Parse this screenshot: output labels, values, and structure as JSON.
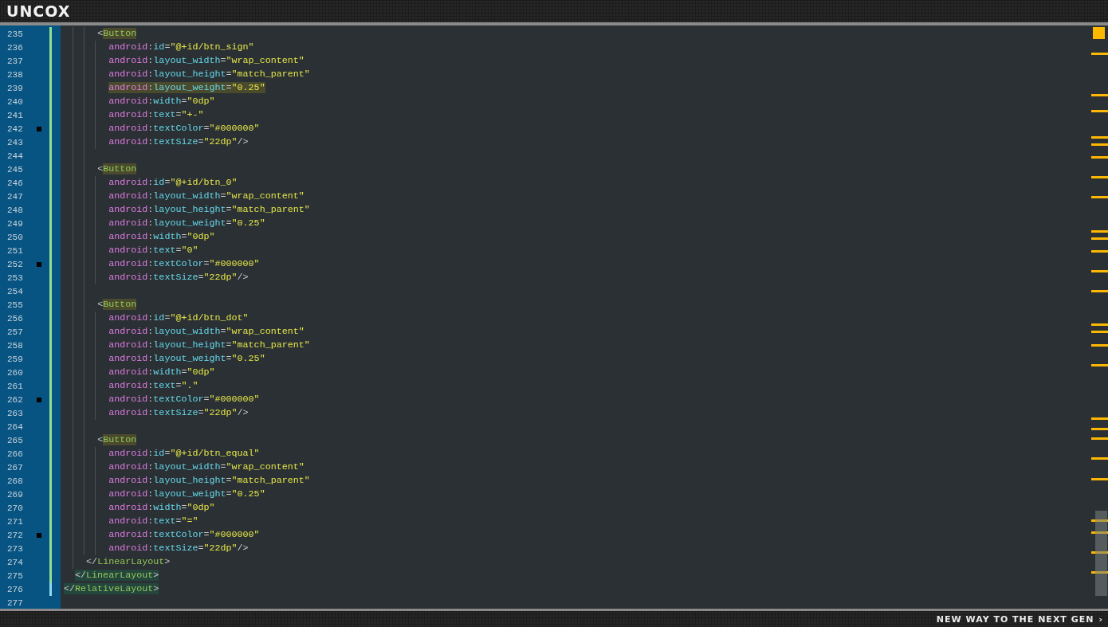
{
  "header": {
    "logo": "UNCOX"
  },
  "editor": {
    "lines": [
      {
        "children": [
          {
            "children": [
              {
                "children": [
                  {
                    "number": "235",
                    "kind": "open_tag",
                    "changed": true,
                    "saved": false,
                    "bookmark": false,
                    "segments": [
                      {
                        "kind": "punct",
                        "text": "<"
                      },
                      {
                        "kind": "tag",
                        "text": "Button",
                        "highlighted": true
                      }
                    ],
                    "children": [
                      {
                        "number": "236",
                        "kind": "attribute",
                        "changed": true,
                        "saved": false,
                        "bookmark": false,
                        "segments": [
                          {
                            "kind": "ns",
                            "text": "android"
                          },
                          {
                            "kind": "punct",
                            "text": ":"
                          },
                          {
                            "kind": "attr",
                            "text": "id"
                          },
                          {
                            "kind": "punct",
                            "text": "="
                          },
                          {
                            "kind": "value",
                            "text": "\"@+id/btn_sign\""
                          }
                        ]
                      },
                      {
                        "number": "237",
                        "kind": "attribute",
                        "changed": true,
                        "saved": false,
                        "bookmark": false,
                        "segments": [
                          {
                            "kind": "ns",
                            "text": "android"
                          },
                          {
                            "kind": "punct",
                            "text": ":"
                          },
                          {
                            "kind": "attr",
                            "text": "layout_width"
                          },
                          {
                            "kind": "punct",
                            "text": "="
                          },
                          {
                            "kind": "value",
                            "text": "\"wrap_content\""
                          }
                        ]
                      },
                      {
                        "number": "238",
                        "kind": "attribute",
                        "changed": true,
                        "saved": false,
                        "bookmark": false,
                        "segments": [
                          {
                            "kind": "ns",
                            "text": "android"
                          },
                          {
                            "kind": "punct",
                            "text": ":"
                          },
                          {
                            "kind": "attr",
                            "text": "layout_height"
                          },
                          {
                            "kind": "punct",
                            "text": "="
                          },
                          {
                            "kind": "value",
                            "text": "\"match_parent\""
                          }
                        ]
                      },
                      {
                        "number": "239",
                        "kind": "attribute",
                        "changed": true,
                        "saved": false,
                        "bookmark": false,
                        "segments": [
                          {
                            "kind": "ns",
                            "text": "android",
                            "highlighted": true
                          },
                          {
                            "kind": "punct",
                            "text": ":",
                            "highlighted": true
                          },
                          {
                            "kind": "attr",
                            "text": "layout_weight",
                            "highlighted": true
                          },
                          {
                            "kind": "punct",
                            "text": "=",
                            "highlighted": true
                          },
                          {
                            "kind": "value",
                            "text": "\"0.25\"",
                            "highlighted": true
                          }
                        ]
                      },
                      {
                        "number": "240",
                        "kind": "attribute",
                        "changed": true,
                        "saved": false,
                        "bookmark": false,
                        "segments": [
                          {
                            "kind": "ns",
                            "text": "android"
                          },
                          {
                            "kind": "punct",
                            "text": ":"
                          },
                          {
                            "kind": "attr",
                            "text": "width"
                          },
                          {
                            "kind": "punct",
                            "text": "="
                          },
                          {
                            "kind": "value",
                            "text": "\"0dp\""
                          }
                        ]
                      },
                      {
                        "number": "241",
                        "kind": "attribute",
                        "changed": true,
                        "saved": false,
                        "bookmark": false,
                        "segments": [
                          {
                            "kind": "ns",
                            "text": "android"
                          },
                          {
                            "kind": "punct",
                            "text": ":"
                          },
                          {
                            "kind": "attr",
                            "text": "text"
                          },
                          {
                            "kind": "punct",
                            "text": "="
                          },
                          {
                            "kind": "value",
                            "text": "\"+-\""
                          }
                        ]
                      },
                      {
                        "number": "242",
                        "kind": "attribute",
                        "changed": true,
                        "saved": false,
                        "bookmark": true,
                        "segments": [
                          {
                            "kind": "ns",
                            "text": "android"
                          },
                          {
                            "kind": "punct",
                            "text": ":"
                          },
                          {
                            "kind": "attr",
                            "text": "textColor"
                          },
                          {
                            "kind": "punct",
                            "text": "="
                          },
                          {
                            "kind": "value",
                            "text": "\"#000000\""
                          }
                        ]
                      },
                      {
                        "number": "243",
                        "kind": "attribute",
                        "changed": true,
                        "saved": false,
                        "bookmark": false,
                        "segments": [
                          {
                            "kind": "ns",
                            "text": "android"
                          },
                          {
                            "kind": "punct",
                            "text": ":"
                          },
                          {
                            "kind": "attr",
                            "text": "textSize"
                          },
                          {
                            "kind": "punct",
                            "text": "="
                          },
                          {
                            "kind": "value",
                            "text": "\"22dp\""
                          },
                          {
                            "kind": "punct",
                            "text": "/>"
                          }
                        ]
                      }
                    ]
                  },
                  {
                    "number": "244",
                    "kind": "blank",
                    "changed": true,
                    "saved": false,
                    "bookmark": false
                  },
                  {
                    "number": "245",
                    "kind": "open_tag",
                    "changed": true,
                    "saved": false,
                    "bookmark": false,
                    "segments": [
                      {
                        "kind": "punct",
                        "text": "<"
                      },
                      {
                        "kind": "tag",
                        "text": "Button",
                        "highlighted": true
                      }
                    ],
                    "children": [
                      {
                        "number": "246",
                        "kind": "attribute",
                        "changed": true,
                        "saved": false,
                        "bookmark": false,
                        "segments": [
                          {
                            "kind": "ns",
                            "text": "android"
                          },
                          {
                            "kind": "punct",
                            "text": ":"
                          },
                          {
                            "kind": "attr",
                            "text": "id"
                          },
                          {
                            "kind": "punct",
                            "text": "="
                          },
                          {
                            "kind": "value",
                            "text": "\"@+id/btn_0\""
                          }
                        ]
                      },
                      {
                        "number": "247",
                        "kind": "attribute",
                        "changed": true,
                        "saved": false,
                        "bookmark": false,
                        "segments": [
                          {
                            "kind": "ns",
                            "text": "android"
                          },
                          {
                            "kind": "punct",
                            "text": ":"
                          },
                          {
                            "kind": "attr",
                            "text": "layout_width"
                          },
                          {
                            "kind": "punct",
                            "text": "="
                          },
                          {
                            "kind": "value",
                            "text": "\"wrap_content\""
                          }
                        ]
                      },
                      {
                        "number": "248",
                        "kind": "attribute",
                        "changed": true,
                        "saved": false,
                        "bookmark": false,
                        "segments": [
                          {
                            "kind": "ns",
                            "text": "android"
                          },
                          {
                            "kind": "punct",
                            "text": ":"
                          },
                          {
                            "kind": "attr",
                            "text": "layout_height"
                          },
                          {
                            "kind": "punct",
                            "text": "="
                          },
                          {
                            "kind": "value",
                            "text": "\"match_parent\""
                          }
                        ]
                      },
                      {
                        "number": "249",
                        "kind": "attribute",
                        "changed": true,
                        "saved": false,
                        "bookmark": false,
                        "segments": [
                          {
                            "kind": "ns",
                            "text": "android"
                          },
                          {
                            "kind": "punct",
                            "text": ":"
                          },
                          {
                            "kind": "attr",
                            "text": "layout_weight"
                          },
                          {
                            "kind": "punct",
                            "text": "="
                          },
                          {
                            "kind": "value",
                            "text": "\"0.25\""
                          }
                        ]
                      },
                      {
                        "number": "250",
                        "kind": "attribute",
                        "changed": true,
                        "saved": false,
                        "bookmark": false,
                        "segments": [
                          {
                            "kind": "ns",
                            "text": "android"
                          },
                          {
                            "kind": "punct",
                            "text": ":"
                          },
                          {
                            "kind": "attr",
                            "text": "width"
                          },
                          {
                            "kind": "punct",
                            "text": "="
                          },
                          {
                            "kind": "value",
                            "text": "\"0dp\""
                          }
                        ]
                      },
                      {
                        "number": "251",
                        "kind": "attribute",
                        "changed": true,
                        "saved": false,
                        "bookmark": false,
                        "segments": [
                          {
                            "kind": "ns",
                            "text": "android"
                          },
                          {
                            "kind": "punct",
                            "text": ":"
                          },
                          {
                            "kind": "attr",
                            "text": "text"
                          },
                          {
                            "kind": "punct",
                            "text": "="
                          },
                          {
                            "kind": "value",
                            "text": "\"0\""
                          }
                        ]
                      },
                      {
                        "number": "252",
                        "kind": "attribute",
                        "changed": true,
                        "saved": false,
                        "bookmark": true,
                        "segments": [
                          {
                            "kind": "ns",
                            "text": "android"
                          },
                          {
                            "kind": "punct",
                            "text": ":"
                          },
                          {
                            "kind": "attr",
                            "text": "textColor"
                          },
                          {
                            "kind": "punct",
                            "text": "="
                          },
                          {
                            "kind": "value",
                            "text": "\"#000000\""
                          }
                        ]
                      },
                      {
                        "number": "253",
                        "kind": "attribute",
                        "changed": true,
                        "saved": false,
                        "bookmark": false,
                        "segments": [
                          {
                            "kind": "ns",
                            "text": "android"
                          },
                          {
                            "kind": "punct",
                            "text": ":"
                          },
                          {
                            "kind": "attr",
                            "text": "textSize"
                          },
                          {
                            "kind": "punct",
                            "text": "="
                          },
                          {
                            "kind": "value",
                            "text": "\"22dp\""
                          },
                          {
                            "kind": "punct",
                            "text": "/>"
                          }
                        ]
                      }
                    ]
                  },
                  {
                    "number": "254",
                    "kind": "blank",
                    "changed": true,
                    "saved": false,
                    "bookmark": false
                  },
                  {
                    "number": "255",
                    "kind": "open_tag",
                    "changed": true,
                    "saved": false,
                    "bookmark": false,
                    "segments": [
                      {
                        "kind": "punct",
                        "text": "<"
                      },
                      {
                        "kind": "tag",
                        "text": "Button",
                        "highlighted": true
                      }
                    ],
                    "children": [
                      {
                        "number": "256",
                        "kind": "attribute",
                        "changed": true,
                        "saved": false,
                        "bookmark": false,
                        "segments": [
                          {
                            "kind": "ns",
                            "text": "android"
                          },
                          {
                            "kind": "punct",
                            "text": ":"
                          },
                          {
                            "kind": "attr",
                            "text": "id"
                          },
                          {
                            "kind": "punct",
                            "text": "="
                          },
                          {
                            "kind": "value",
                            "text": "\"@+id/btn_dot\""
                          }
                        ]
                      },
                      {
                        "number": "257",
                        "kind": "attribute",
                        "changed": true,
                        "saved": false,
                        "bookmark": false,
                        "segments": [
                          {
                            "kind": "ns",
                            "text": "android"
                          },
                          {
                            "kind": "punct",
                            "text": ":"
                          },
                          {
                            "kind": "attr",
                            "text": "layout_width"
                          },
                          {
                            "kind": "punct",
                            "text": "="
                          },
                          {
                            "kind": "value",
                            "text": "\"wrap_content\""
                          }
                        ]
                      },
                      {
                        "number": "258",
                        "kind": "attribute",
                        "changed": true,
                        "saved": false,
                        "bookmark": false,
                        "segments": [
                          {
                            "kind": "ns",
                            "text": "android"
                          },
                          {
                            "kind": "punct",
                            "text": ":"
                          },
                          {
                            "kind": "attr",
                            "text": "layout_height"
                          },
                          {
                            "kind": "punct",
                            "text": "="
                          },
                          {
                            "kind": "value",
                            "text": "\"match_parent\""
                          }
                        ]
                      },
                      {
                        "number": "259",
                        "kind": "attribute",
                        "changed": true,
                        "saved": false,
                        "bookmark": false,
                        "segments": [
                          {
                            "kind": "ns",
                            "text": "android"
                          },
                          {
                            "kind": "punct",
                            "text": ":"
                          },
                          {
                            "kind": "attr",
                            "text": "layout_weight"
                          },
                          {
                            "kind": "punct",
                            "text": "="
                          },
                          {
                            "kind": "value",
                            "text": "\"0.25\""
                          }
                        ]
                      },
                      {
                        "number": "260",
                        "kind": "attribute",
                        "changed": true,
                        "saved": false,
                        "bookmark": false,
                        "segments": [
                          {
                            "kind": "ns",
                            "text": "android"
                          },
                          {
                            "kind": "punct",
                            "text": ":"
                          },
                          {
                            "kind": "attr",
                            "text": "width"
                          },
                          {
                            "kind": "punct",
                            "text": "="
                          },
                          {
                            "kind": "value",
                            "text": "\"0dp\""
                          }
                        ]
                      },
                      {
                        "number": "261",
                        "kind": "attribute",
                        "changed": true,
                        "saved": false,
                        "bookmark": false,
                        "segments": [
                          {
                            "kind": "ns",
                            "text": "android"
                          },
                          {
                            "kind": "punct",
                            "text": ":"
                          },
                          {
                            "kind": "attr",
                            "text": "text"
                          },
                          {
                            "kind": "punct",
                            "text": "="
                          },
                          {
                            "kind": "value",
                            "text": "\".\""
                          }
                        ]
                      },
                      {
                        "number": "262",
                        "kind": "attribute",
                        "changed": true,
                        "saved": false,
                        "bookmark": true,
                        "segments": [
                          {
                            "kind": "ns",
                            "text": "android"
                          },
                          {
                            "kind": "punct",
                            "text": ":"
                          },
                          {
                            "kind": "attr",
                            "text": "textColor"
                          },
                          {
                            "kind": "punct",
                            "text": "="
                          },
                          {
                            "kind": "value",
                            "text": "\"#000000\""
                          }
                        ]
                      },
                      {
                        "number": "263",
                        "kind": "attribute",
                        "changed": true,
                        "saved": false,
                        "bookmark": false,
                        "segments": [
                          {
                            "kind": "ns",
                            "text": "android"
                          },
                          {
                            "kind": "punct",
                            "text": ":"
                          },
                          {
                            "kind": "attr",
                            "text": "textSize"
                          },
                          {
                            "kind": "punct",
                            "text": "="
                          },
                          {
                            "kind": "value",
                            "text": "\"22dp\""
                          },
                          {
                            "kind": "punct",
                            "text": "/>"
                          }
                        ]
                      }
                    ]
                  },
                  {
                    "number": "264",
                    "kind": "blank",
                    "changed": true,
                    "saved": false,
                    "bookmark": false
                  },
                  {
                    "number": "265",
                    "kind": "open_tag",
                    "changed": true,
                    "saved": false,
                    "bookmark": false,
                    "segments": [
                      {
                        "kind": "punct",
                        "text": "<"
                      },
                      {
                        "kind": "tag",
                        "text": "Button",
                        "highlighted": true
                      }
                    ],
                    "children": [
                      {
                        "number": "266",
                        "kind": "attribute",
                        "changed": true,
                        "saved": false,
                        "bookmark": false,
                        "segments": [
                          {
                            "kind": "ns",
                            "text": "android"
                          },
                          {
                            "kind": "punct",
                            "text": ":"
                          },
                          {
                            "kind": "attr",
                            "text": "id"
                          },
                          {
                            "kind": "punct",
                            "text": "="
                          },
                          {
                            "kind": "value",
                            "text": "\"@+id/btn_equal\""
                          }
                        ]
                      },
                      {
                        "number": "267",
                        "kind": "attribute",
                        "changed": true,
                        "saved": false,
                        "bookmark": false,
                        "segments": [
                          {
                            "kind": "ns",
                            "text": "android"
                          },
                          {
                            "kind": "punct",
                            "text": ":"
                          },
                          {
                            "kind": "attr",
                            "text": "layout_width"
                          },
                          {
                            "kind": "punct",
                            "text": "="
                          },
                          {
                            "kind": "value",
                            "text": "\"wrap_content\""
                          }
                        ]
                      },
                      {
                        "number": "268",
                        "kind": "attribute",
                        "changed": true,
                        "saved": false,
                        "bookmark": false,
                        "segments": [
                          {
                            "kind": "ns",
                            "text": "android"
                          },
                          {
                            "kind": "punct",
                            "text": ":"
                          },
                          {
                            "kind": "attr",
                            "text": "layout_height"
                          },
                          {
                            "kind": "punct",
                            "text": "="
                          },
                          {
                            "kind": "value",
                            "text": "\"match_parent\""
                          }
                        ]
                      },
                      {
                        "number": "269",
                        "kind": "attribute",
                        "changed": true,
                        "saved": false,
                        "bookmark": false,
                        "segments": [
                          {
                            "kind": "ns",
                            "text": "android"
                          },
                          {
                            "kind": "punct",
                            "text": ":"
                          },
                          {
                            "kind": "attr",
                            "text": "layout_weight"
                          },
                          {
                            "kind": "punct",
                            "text": "="
                          },
                          {
                            "kind": "value",
                            "text": "\"0.25\""
                          }
                        ]
                      },
                      {
                        "number": "270",
                        "kind": "attribute",
                        "changed": true,
                        "saved": false,
                        "bookmark": false,
                        "segments": [
                          {
                            "kind": "ns",
                            "text": "android"
                          },
                          {
                            "kind": "punct",
                            "text": ":"
                          },
                          {
                            "kind": "attr",
                            "text": "width"
                          },
                          {
                            "kind": "punct",
                            "text": "="
                          },
                          {
                            "kind": "value",
                            "text": "\"0dp\""
                          }
                        ]
                      },
                      {
                        "number": "271",
                        "kind": "attribute",
                        "changed": true,
                        "saved": false,
                        "bookmark": false,
                        "segments": [
                          {
                            "kind": "ns",
                            "text": "android"
                          },
                          {
                            "kind": "punct",
                            "text": ":"
                          },
                          {
                            "kind": "attr",
                            "text": "text"
                          },
                          {
                            "kind": "punct",
                            "text": "="
                          },
                          {
                            "kind": "value",
                            "text": "\"=\""
                          }
                        ]
                      },
                      {
                        "number": "272",
                        "kind": "attribute",
                        "changed": true,
                        "saved": false,
                        "bookmark": true,
                        "segments": [
                          {
                            "kind": "ns",
                            "text": "android"
                          },
                          {
                            "kind": "punct",
                            "text": ":"
                          },
                          {
                            "kind": "attr",
                            "text": "textColor"
                          },
                          {
                            "kind": "punct",
                            "text": "="
                          },
                          {
                            "kind": "value",
                            "text": "\"#000000\""
                          }
                        ]
                      },
                      {
                        "number": "273",
                        "kind": "attribute",
                        "changed": true,
                        "saved": false,
                        "bookmark": false,
                        "segments": [
                          {
                            "kind": "ns",
                            "text": "android"
                          },
                          {
                            "kind": "punct",
                            "text": ":"
                          },
                          {
                            "kind": "attr",
                            "text": "textSize"
                          },
                          {
                            "kind": "punct",
                            "text": "="
                          },
                          {
                            "kind": "value",
                            "text": "\"22dp\""
                          },
                          {
                            "kind": "punct",
                            "text": "/>"
                          }
                        ]
                      }
                    ]
                  }
                ]
              },
              {
                "number": "274",
                "kind": "close_tag",
                "changed": true,
                "saved": false,
                "bookmark": false,
                "segments": [
                  {
                    "kind": "punct",
                    "text": "</"
                  },
                  {
                    "kind": "tag",
                    "text": "LinearLayout"
                  },
                  {
                    "kind": "punct",
                    "text": ">"
                  }
                ]
              }
            ]
          },
          {
            "number": "275",
            "kind": "close_tag",
            "changed": true,
            "saved": false,
            "bookmark": false,
            "segments": [
              {
                "kind": "punct",
                "text": "</",
                "highlighted": true
              },
              {
                "kind": "tag",
                "text": "LinearLayout",
                "highlighted": true
              },
              {
                "kind": "punct",
                "text": ">",
                "highlighted": true
              }
            ]
          }
        ]
      },
      {
        "number": "276",
        "kind": "close_tag",
        "changed": true,
        "saved": true,
        "bookmark": false,
        "segments": [
          {
            "kind": "punct",
            "text": "</",
            "highlighted": true
          },
          {
            "kind": "tag",
            "text": "RelativeLayout",
            "highlighted": true
          },
          {
            "kind": "punct",
            "text": ">",
            "highlighted": true
          }
        ]
      },
      {
        "number": "277",
        "changed": false,
        "saved": false,
        "bookmark": false
      }
    ]
  },
  "footer": {
    "slogan": "NEW WAY TO THE NEXT GEN",
    "arrow": "›"
  }
}
